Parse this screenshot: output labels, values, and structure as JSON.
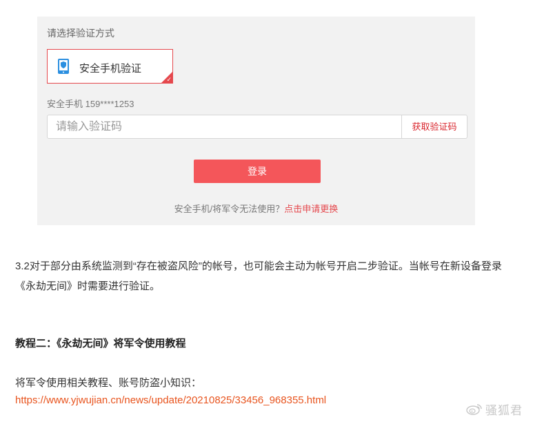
{
  "verify": {
    "title": "请选择验证方式",
    "method_label": "安全手机验证",
    "phone_line": "安全手机 159****1253",
    "code_placeholder": "请输入验证码",
    "get_code_label": "获取验证码",
    "login_label": "登录",
    "help_text": "安全手机/将军令无法使用？",
    "help_link": "点击申请更换"
  },
  "article": {
    "paragraph": "3.2对于部分由系统监测到“存在被盗风险”的帐号，也可能会主动为帐号开启二步验证。当帐号在新设备登录《永劫无间》时需要进行验证。",
    "heading": "教程二：《永劫无间》将军令使用教程",
    "links_intro": "将军令使用相关教程、账号防盗小知识：",
    "url": "https://www.yjwujian.cn/news/update/20210825/33456_968355.html"
  },
  "watermark": {
    "text": "骚狐君",
    "icon": "weibo-icon"
  },
  "colors": {
    "accent": "#e5484d",
    "login_button": "#f4565a",
    "link": "#e8541e",
    "panel_bg": "#f2f2f2",
    "phone_icon": "#2b8fe0"
  }
}
